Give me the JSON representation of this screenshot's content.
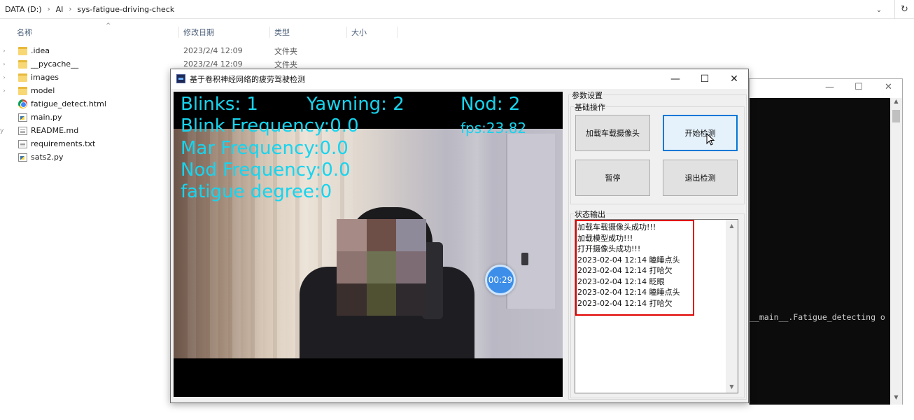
{
  "explorer": {
    "breadcrumb": [
      "DATA (D:)",
      "AI",
      "sys-fatigue-driving-check"
    ],
    "columns": {
      "name": "名称",
      "modified": "修改日期",
      "type": "类型",
      "size": "大小"
    },
    "files": [
      {
        "name": ".idea",
        "date": "2023/2/4 12:09",
        "type": "文件夹",
        "icon": "folder-icon"
      },
      {
        "name": "__pycache__",
        "date": "2023/2/4 12:09",
        "type": "文件夹",
        "icon": "folder-icon"
      },
      {
        "name": "images",
        "date": "",
        "type": "",
        "icon": "folder-icon"
      },
      {
        "name": "model",
        "date": "",
        "type": "",
        "icon": "folder-icon"
      },
      {
        "name": "fatigue_detect.html",
        "date": "",
        "type": "",
        "icon": "chrome-icon"
      },
      {
        "name": "main.py",
        "date": "",
        "type": "",
        "icon": "python-file-icon"
      },
      {
        "name": "README.md",
        "date": "",
        "type": "",
        "icon": "text-file-icon"
      },
      {
        "name": "requirements.txt",
        "date": "",
        "type": "",
        "icon": "text-file-icon"
      },
      {
        "name": "sats2.py",
        "date": "",
        "type": "",
        "icon": "python-file-icon"
      }
    ]
  },
  "console": {
    "output": "__main__.Fatigue_detecting o"
  },
  "app": {
    "title": "基于卷积神经网络的疲劳驾驶检测",
    "video_overlay": {
      "blinks": "Blinks: 1",
      "yawning": "Yawning: 2",
      "nod": "Nod: 2",
      "blink_freq": "Blink Frequency:0.0",
      "fps": "fps:23.82",
      "mar_freq": "Mar Frequency:0.0",
      "nod_freq": "Nod Frequency:0.0",
      "fatigue": "fatigue degree:0",
      "timer": "00:29"
    },
    "panel": {
      "params_group": "参数设置",
      "basic_group": "基础操作",
      "buttons": {
        "load_camera": "加载车载摄像头",
        "start": "开始检测",
        "pause": "暂停",
        "exit": "退出检测"
      },
      "status_group": "状态输出",
      "log": [
        "加载车载摄像头成功!!!",
        "加载模型成功!!!",
        "打开摄像头成功!!!",
        "2023-02-04 12:14 瞌睡点头",
        "2023-02-04 12:14 打哈欠",
        "2023-02-04 12:14 眨眼",
        "2023-02-04 12:14 瞌睡点头",
        "2023-02-04 12:14 打哈欠"
      ]
    }
  },
  "colors": {
    "overlay_text": "#17d4ee",
    "highlight_border": "#e00000",
    "focus_button": "#0078d7"
  }
}
